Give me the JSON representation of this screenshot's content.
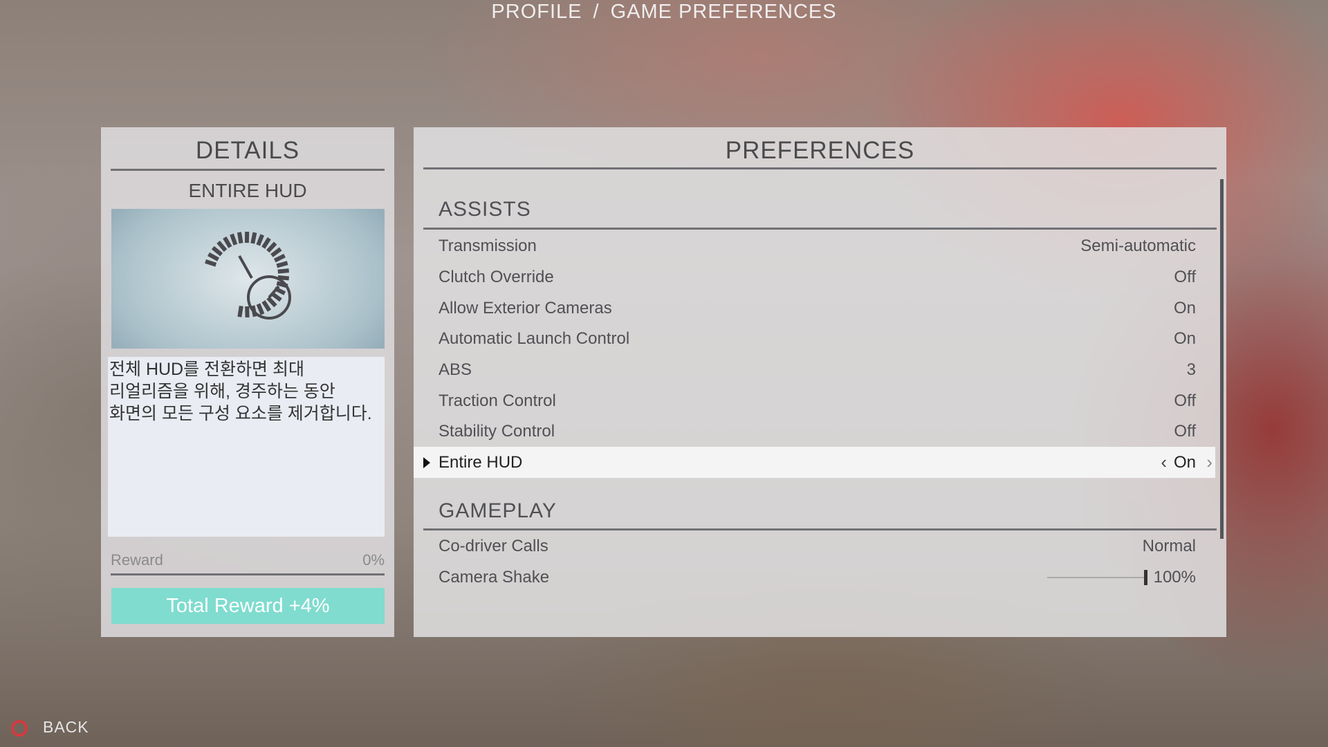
{
  "breadcrumb": {
    "profile": "PROFILE",
    "separator": "/",
    "page": "GAME PREFERENCES"
  },
  "details": {
    "title": "DETAILS",
    "subtitle": "ENTIRE HUD",
    "image_icon": "speedometer-icon",
    "description": "전체 HUD를 전환하면 최대\n리얼리즘을 위해, 경주하는 동안\n화면의 모든 구성 요소를 제거합니다.",
    "reward_label": "Reward",
    "reward_value": "0%",
    "total_reward": "Total Reward +4%",
    "total_color": "#7fdccf"
  },
  "preferences": {
    "title": "PREFERENCES",
    "assists": {
      "heading": "ASSISTS",
      "rows": [
        {
          "label": "Transmission",
          "value": "Semi-automatic"
        },
        {
          "label": "Clutch Override",
          "value": "Off"
        },
        {
          "label": "Allow Exterior Cameras",
          "value": "On"
        },
        {
          "label": "Automatic Launch Control",
          "value": "On"
        },
        {
          "label": "ABS",
          "value": "3"
        },
        {
          "label": "Traction Control",
          "value": "Off"
        },
        {
          "label": "Stability Control",
          "value": "Off"
        },
        {
          "label": "Entire HUD",
          "value": "On",
          "selected": true
        }
      ]
    },
    "gameplay": {
      "heading": "GAMEPLAY",
      "rows": [
        {
          "label": "Co-driver Calls",
          "value": "Normal"
        },
        {
          "label": "Camera Shake",
          "value": "100%",
          "slider_level": 1.0
        }
      ]
    }
  },
  "footer": {
    "back_label": "BACK",
    "back_icon": "circle-button-icon",
    "back_icon_color": "#d43a40"
  }
}
